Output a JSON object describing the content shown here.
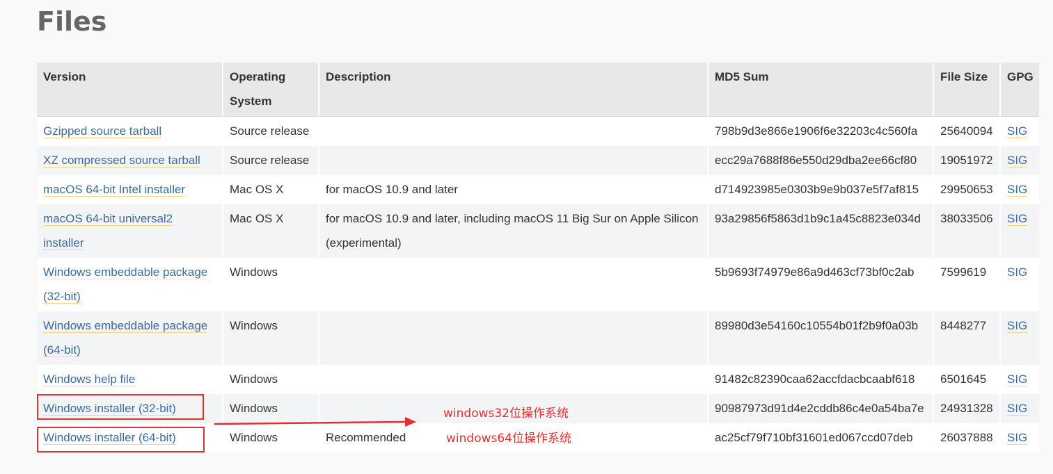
{
  "page": {
    "title": "Files"
  },
  "table": {
    "headers": {
      "version": "Version",
      "os": "Operating System",
      "description": "Description",
      "md5": "MD5 Sum",
      "size": "File Size",
      "gpg": "GPG"
    },
    "rows": [
      {
        "version": "Gzipped source tarball",
        "os": "Source release",
        "description": "",
        "md5": "798b9d3e866e1906f6e32203c4c560fa",
        "size": "25640094",
        "gpg": "SIG"
      },
      {
        "version": "XZ compressed source tarball",
        "os": "Source release",
        "description": "",
        "md5": "ecc29a7688f86e550d29dba2ee66cf80",
        "size": "19051972",
        "gpg": "SIG"
      },
      {
        "version": "macOS 64-bit Intel installer",
        "os": "Mac OS X",
        "description": "for macOS 10.9 and later",
        "md5": "d714923985e0303b9e9b037e5f7af815",
        "size": "29950653",
        "gpg": "SIG"
      },
      {
        "version": "macOS 64-bit universal2 installer",
        "os": "Mac OS X",
        "description": "for macOS 10.9 and later, including macOS 11 Big Sur on Apple Silicon (experimental)",
        "md5": "93a29856f5863d1b9c1a45c8823e034d",
        "size": "38033506",
        "gpg": "SIG"
      },
      {
        "version": "Windows embeddable package (32-bit)",
        "os": "Windows",
        "description": "",
        "md5": "5b9693f74979e86a9d463cf73bf0c2ab",
        "size": "7599619",
        "gpg": "SIG"
      },
      {
        "version": "Windows embeddable package (64-bit)",
        "os": "Windows",
        "description": "",
        "md5": "89980d3e54160c10554b01f2b9f0a03b",
        "size": "8448277",
        "gpg": "SIG"
      },
      {
        "version": "Windows help file",
        "os": "Windows",
        "description": "",
        "md5": "91482c82390caa62accfdacbcaabf618",
        "size": "6501645",
        "gpg": "SIG"
      },
      {
        "version": "Windows installer (32-bit)",
        "os": "Windows",
        "description": "",
        "md5": "90987973d91d4e2cddb86c4e0a54ba7e",
        "size": "24931328",
        "gpg": "SIG"
      },
      {
        "version": "Windows installer (64-bit)",
        "os": "Windows",
        "description": "Recommended",
        "md5": "ac25cf79f710bf31601ed067ccd07deb",
        "size": "26037888",
        "gpg": "SIG"
      }
    ]
  },
  "annotations": {
    "label_32": "windows32位操作系统",
    "label_64": "windows64位操作系统",
    "color": "#e32f2f"
  },
  "colors": {
    "link": "#3b6b9a",
    "link_underline": "#f4d87a",
    "header_bg": "#e6e8ea",
    "row_alt_bg": "#f2f4f6"
  }
}
